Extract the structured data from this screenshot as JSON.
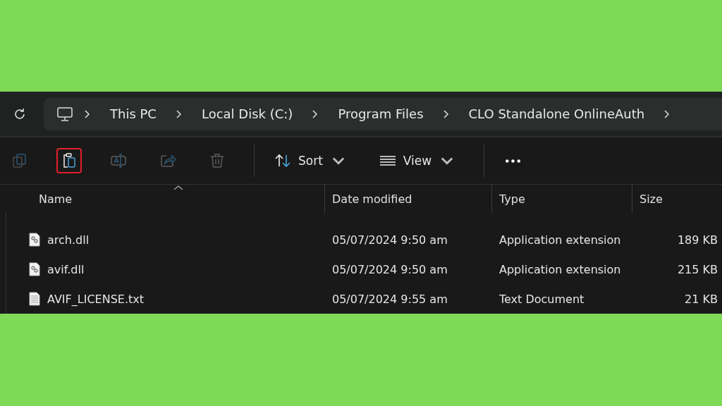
{
  "breadcrumb": [
    "This PC",
    "Local Disk (C:)",
    "Program Files",
    "CLO Standalone OnlineAuth"
  ],
  "toolbar": [
    {
      "kind": "copy",
      "disabled": true,
      "highlighted": false
    },
    {
      "kind": "paste",
      "disabled": false,
      "highlighted": true
    },
    {
      "kind": "rename",
      "disabled": true,
      "highlighted": false
    },
    {
      "kind": "share",
      "disabled": true,
      "highlighted": false
    },
    {
      "kind": "delete",
      "disabled": true,
      "highlighted": false
    },
    {
      "kind": "sort",
      "label": "Sort",
      "disabled": false,
      "highlighted": false
    },
    {
      "kind": "view",
      "label": "View",
      "disabled": false,
      "highlighted": false
    },
    {
      "kind": "more",
      "disabled": false,
      "highlighted": false
    }
  ],
  "table": {
    "columns": [
      "Name",
      "Date modified",
      "Type",
      "Size"
    ],
    "rows": [
      {
        "kind": "dll",
        "name": "arch.dll",
        "date": "05/07/2024 9:50 am",
        "type": "Application extension",
        "size": "189 KB"
      },
      {
        "kind": "dll",
        "name": "avif.dll",
        "date": "05/07/2024 9:50 am",
        "type": "Application extension",
        "size": "215 KB"
      },
      {
        "kind": "txt",
        "name": "AVIF_LICENSE.txt",
        "date": "05/07/2024 9:55 am",
        "type": "Text Document",
        "size": "21 KB"
      }
    ]
  }
}
